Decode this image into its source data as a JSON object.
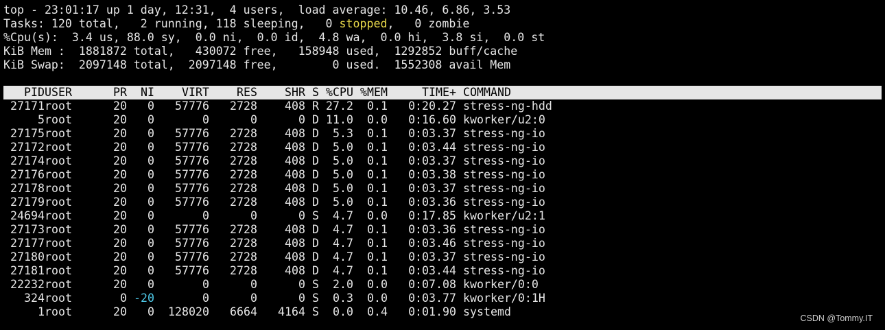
{
  "summary": {
    "line1": "top - 23:01:17 up 1 day, 12:31,  4 users,  load average: 10.46, 6.86, 3.53",
    "line2_pre": "Tasks: 120 total,   2 running, 118 sleeping,   0 ",
    "line2_stopped": "stopped",
    "line2_post": ",   0 zombie",
    "line3": "%Cpu(s):  3.4 us, 88.0 sy,  0.0 ni,  0.0 id,  4.8 wa,  0.0 hi,  3.8 si,  0.0 st",
    "line4": "KiB Mem :  1881872 total,   430072 free,   158948 used,  1292852 buff/cache",
    "line5": "KiB Swap:  2097148 total,  2097148 free,        0 used.  1552308 avail Mem"
  },
  "columns": {
    "pid": "PID",
    "user": "USER",
    "pr": "PR",
    "ni": "NI",
    "virt": "VIRT",
    "res": "RES",
    "shr": "SHR",
    "s": "S",
    "cpu": "%CPU",
    "mem": "%MEM",
    "time": "TIME+",
    "command": "COMMAND"
  },
  "processes": [
    {
      "pid": "27171",
      "user": "root",
      "pr": "20",
      "ni": "0",
      "virt": "57776",
      "res": "2728",
      "shr": "408",
      "s": "R",
      "cpu": "27.2",
      "mem": "0.1",
      "time": "0:20.27",
      "command": "stress-ng-hdd"
    },
    {
      "pid": "5",
      "user": "root",
      "pr": "20",
      "ni": "0",
      "virt": "0",
      "res": "0",
      "shr": "0",
      "s": "D",
      "cpu": "11.0",
      "mem": "0.0",
      "time": "0:16.60",
      "command": "kworker/u2:0"
    },
    {
      "pid": "27175",
      "user": "root",
      "pr": "20",
      "ni": "0",
      "virt": "57776",
      "res": "2728",
      "shr": "408",
      "s": "D",
      "cpu": "5.3",
      "mem": "0.1",
      "time": "0:03.37",
      "command": "stress-ng-io"
    },
    {
      "pid": "27172",
      "user": "root",
      "pr": "20",
      "ni": "0",
      "virt": "57776",
      "res": "2728",
      "shr": "408",
      "s": "D",
      "cpu": "5.0",
      "mem": "0.1",
      "time": "0:03.44",
      "command": "stress-ng-io"
    },
    {
      "pid": "27174",
      "user": "root",
      "pr": "20",
      "ni": "0",
      "virt": "57776",
      "res": "2728",
      "shr": "408",
      "s": "D",
      "cpu": "5.0",
      "mem": "0.1",
      "time": "0:03.37",
      "command": "stress-ng-io"
    },
    {
      "pid": "27176",
      "user": "root",
      "pr": "20",
      "ni": "0",
      "virt": "57776",
      "res": "2728",
      "shr": "408",
      "s": "D",
      "cpu": "5.0",
      "mem": "0.1",
      "time": "0:03.38",
      "command": "stress-ng-io"
    },
    {
      "pid": "27178",
      "user": "root",
      "pr": "20",
      "ni": "0",
      "virt": "57776",
      "res": "2728",
      "shr": "408",
      "s": "D",
      "cpu": "5.0",
      "mem": "0.1",
      "time": "0:03.37",
      "command": "stress-ng-io"
    },
    {
      "pid": "27179",
      "user": "root",
      "pr": "20",
      "ni": "0",
      "virt": "57776",
      "res": "2728",
      "shr": "408",
      "s": "D",
      "cpu": "5.0",
      "mem": "0.1",
      "time": "0:03.36",
      "command": "stress-ng-io"
    },
    {
      "pid": "24694",
      "user": "root",
      "pr": "20",
      "ni": "0",
      "virt": "0",
      "res": "0",
      "shr": "0",
      "s": "S",
      "cpu": "4.7",
      "mem": "0.0",
      "time": "0:17.85",
      "command": "kworker/u2:1"
    },
    {
      "pid": "27173",
      "user": "root",
      "pr": "20",
      "ni": "0",
      "virt": "57776",
      "res": "2728",
      "shr": "408",
      "s": "D",
      "cpu": "4.7",
      "mem": "0.1",
      "time": "0:03.36",
      "command": "stress-ng-io"
    },
    {
      "pid": "27177",
      "user": "root",
      "pr": "20",
      "ni": "0",
      "virt": "57776",
      "res": "2728",
      "shr": "408",
      "s": "D",
      "cpu": "4.7",
      "mem": "0.1",
      "time": "0:03.46",
      "command": "stress-ng-io"
    },
    {
      "pid": "27180",
      "user": "root",
      "pr": "20",
      "ni": "0",
      "virt": "57776",
      "res": "2728",
      "shr": "408",
      "s": "D",
      "cpu": "4.7",
      "mem": "0.1",
      "time": "0:03.37",
      "command": "stress-ng-io"
    },
    {
      "pid": "27181",
      "user": "root",
      "pr": "20",
      "ni": "0",
      "virt": "57776",
      "res": "2728",
      "shr": "408",
      "s": "D",
      "cpu": "4.7",
      "mem": "0.1",
      "time": "0:03.44",
      "command": "stress-ng-io"
    },
    {
      "pid": "22232",
      "user": "root",
      "pr": "20",
      "ni": "0",
      "virt": "0",
      "res": "0",
      "shr": "0",
      "s": "S",
      "cpu": "2.0",
      "mem": "0.0",
      "time": "0:07.08",
      "command": "kworker/0:0"
    },
    {
      "pid": "324",
      "user": "root",
      "pr": "0",
      "ni": "-20",
      "virt": "0",
      "res": "0",
      "shr": "0",
      "s": "S",
      "cpu": "0.3",
      "mem": "0.0",
      "time": "0:03.77",
      "command": "kworker/0:1H",
      "ni_highlight": true
    },
    {
      "pid": "1",
      "user": "root",
      "pr": "20",
      "ni": "0",
      "virt": "128020",
      "res": "6664",
      "shr": "4164",
      "s": "S",
      "cpu": "0.0",
      "mem": "0.4",
      "time": "0:01.90",
      "command": "systemd"
    }
  ],
  "colors": {
    "background": "#000000",
    "text": "#e6e6e6",
    "header_bg": "#e6e6e6",
    "stopped": "#e8d84a",
    "negative_nice": "#4ec9e8"
  },
  "watermark": "CSDN @Tommy.IT"
}
